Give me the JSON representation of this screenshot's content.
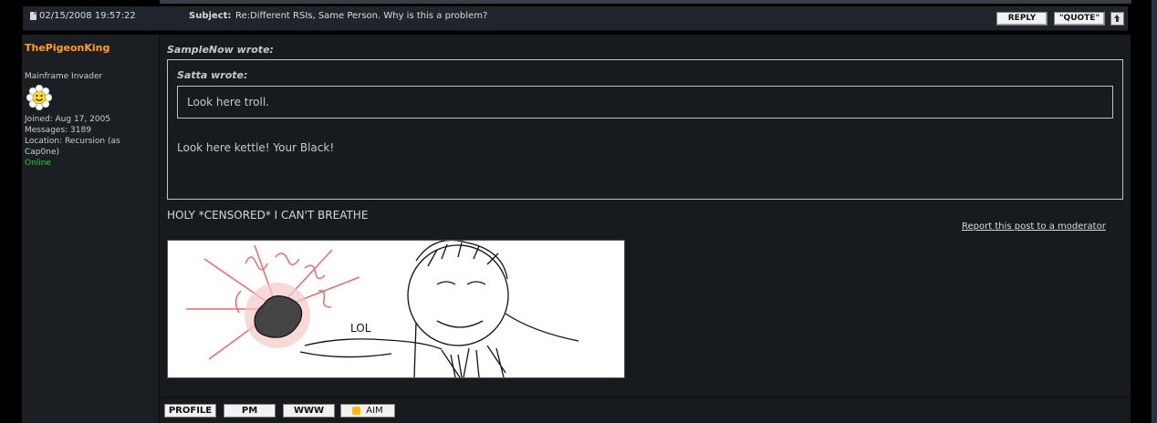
{
  "header": {
    "date": "02/15/2008 19:57:22",
    "subject_label": "Subject:",
    "subject": "Re:Different RSIs, Same Person. Why is this a problem?",
    "reply_label": "REPLY",
    "quote_label": "\"QUOTE\""
  },
  "author": {
    "username": "ThePigeonKing",
    "rank": "Mainframe Invader",
    "joined": "Joined: Aug 17, 2005",
    "messages": "Messages: 3189",
    "location": "Location: Recursion (as",
    "location2": "Cap0ne)",
    "status": "Online"
  },
  "post": {
    "outer_quote_author": "SampleNow wrote:",
    "inner_quote_author": "Satta wrote:",
    "inner_quote_text": "Look here troll.",
    "outer_quote_text": "Look here kettle! Your Black!",
    "body": "HOLY *CENSORED* I CAN'T BREATHE",
    "report_link": "Report this post to a moderator",
    "image_caption": "LOL"
  },
  "footer": {
    "profile": "PROFILE",
    "pm": "PM",
    "www": "WWW",
    "aim": "AIM"
  },
  "colors": {
    "username": "#ff9f24",
    "online": "#2bd02b",
    "background": "#171b20"
  }
}
